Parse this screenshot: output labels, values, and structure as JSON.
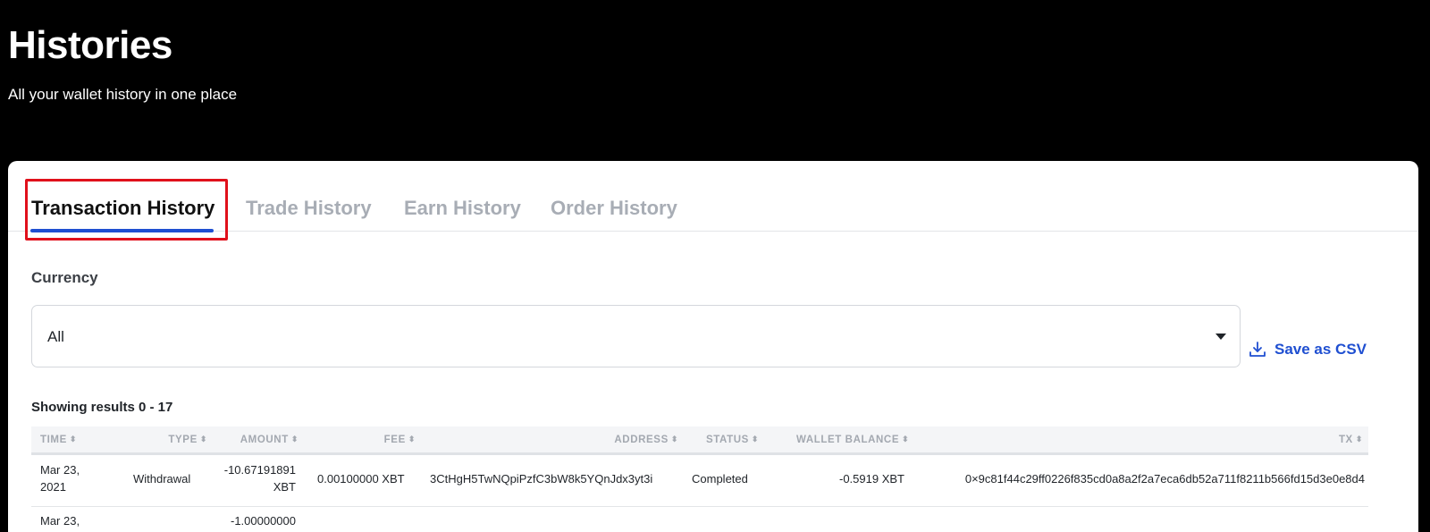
{
  "header": {
    "title": "Histories",
    "subtitle": "All your wallet history in one place"
  },
  "tabs": [
    {
      "label": "Transaction History",
      "active": true
    },
    {
      "label": "Trade History",
      "active": false
    },
    {
      "label": "Earn History",
      "active": false
    },
    {
      "label": "Order History",
      "active": false
    }
  ],
  "filters": {
    "currency_label": "Currency",
    "currency_value": "All"
  },
  "actions": {
    "save_csv_label": "Save as CSV"
  },
  "results": {
    "text": "Showing results 0 - 17"
  },
  "table": {
    "columns": [
      "TIME",
      "TYPE",
      "AMOUNT",
      "FEE",
      "ADDRESS",
      "STATUS",
      "WALLET BALANCE",
      "TX"
    ],
    "sort_glyph": "⬍",
    "rows": [
      {
        "time_line1": "Mar 23,",
        "time_line2": "2021",
        "type": "Withdrawal",
        "amount_line1": "-10.67191891",
        "amount_line2": "XBT",
        "fee": "0.00100000 XBT",
        "address": "3CtHgH5TwNQpiPzfC3bW8k5YQnJdx3yt3i",
        "status": "Completed",
        "wallet_balance": "-0.5919 XBT",
        "tx": "0×9c81f44c29ff0226f835cd0a8a2f2a7eca6db52a711f8211b566fd15d3e0e8d4"
      },
      {
        "time_line1": "Mar 23,",
        "amount_line1": "-1.00000000"
      }
    ]
  },
  "colors": {
    "accent": "#1f4fd1",
    "highlight_box": "#e0101b"
  }
}
